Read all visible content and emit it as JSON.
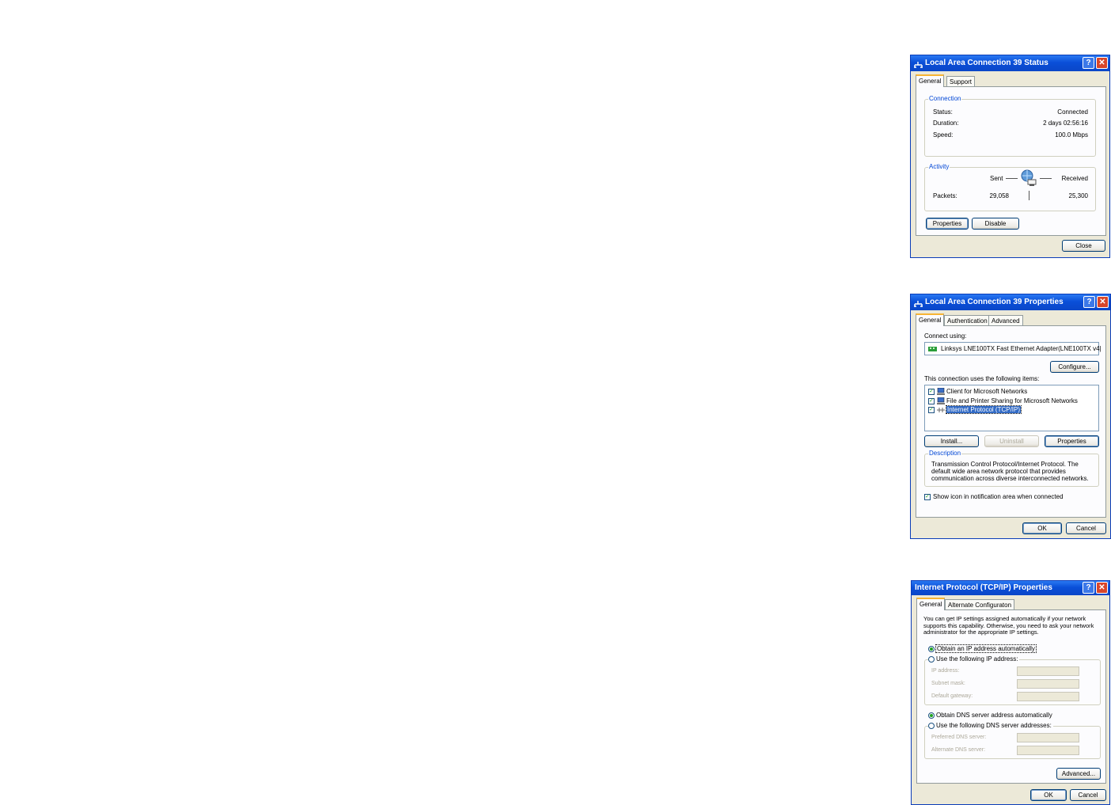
{
  "status_dialog": {
    "title": "Local Area Connection 39 Status",
    "tabs": [
      "General",
      "Support"
    ],
    "connection_legend": "Connection",
    "status_label": "Status:",
    "status_value": "Connected",
    "duration_label": "Duration:",
    "duration_value": "2 days 02:56:16",
    "speed_label": "Speed:",
    "speed_value": "100.0 Mbps",
    "activity_legend": "Activity",
    "sent_label": "Sent",
    "received_label": "Received",
    "packets_label": "Packets:",
    "packets_sent": "29,058",
    "packets_received": "25,300",
    "properties_button": "Properties",
    "disable_button": "Disable",
    "close_button": "Close"
  },
  "properties_dialog": {
    "title": "Local Area Connection 39 Properties",
    "tabs": [
      "General",
      "Authentication",
      "Advanced"
    ],
    "connect_using_label": "Connect using:",
    "adapter_name": "Linksys LNE100TX Fast Ethernet Adapter(LNE100TX v4|",
    "configure_button": "Configure...",
    "items_label": "This connection uses the following items:",
    "items": [
      {
        "label": "Client for Microsoft Networks",
        "checked": true
      },
      {
        "label": "File and Printer Sharing for Microsoft Networks",
        "checked": true
      },
      {
        "label": "Internet Protocol (TCP/IP)",
        "checked": true,
        "selected": true
      }
    ],
    "install_button": "Install...",
    "uninstall_button": "Uninstall",
    "properties_button": "Properties",
    "description_legend": "Description",
    "description_text": "Transmission Control Protocol/Internet Protocol. The default wide area network protocol that provides communication across diverse interconnected networks.",
    "show_icon_label": "Show icon in notification area when connected",
    "ok_button": "OK",
    "cancel_button": "Cancel"
  },
  "tcpip_dialog": {
    "title": "Internet Protocol (TCP/IP) Properties",
    "tabs": [
      "General",
      "Alternate Configuraton"
    ],
    "intro_text": "You can get IP settings assigned automatically if your network supports this capability. Otherwise, you need to ask your network administrator for the appropriate IP settings.",
    "obtain_ip_auto": "Obtain an IP address automatically",
    "use_following_ip": "Use the following IP address:",
    "ip_address_label": "IP address:",
    "subnet_mask_label": "Subnet mask:",
    "default_gateway_label": "Default gateway:",
    "obtain_dns_auto": "Obtain DNS server address automatically",
    "use_following_dns": "Use the following DNS server addresses:",
    "preferred_dns_label": "Preferred DNS server:",
    "alternate_dns_label": "Alternate DNS server:",
    "advanced_button": "Advanced...",
    "ok_button": "OK",
    "cancel_button": "Cancel"
  },
  "icons": {
    "network": "network-connection-icon",
    "help": "?",
    "close": "✕"
  }
}
